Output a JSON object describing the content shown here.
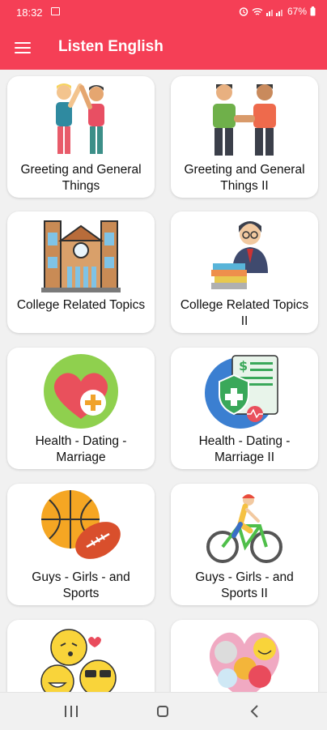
{
  "status_bar": {
    "time": "18:32",
    "battery": "67%"
  },
  "app_bar": {
    "title": "Listen English",
    "menu_icon": "hamburger-menu-icon",
    "color": "#f53f56"
  },
  "cards": [
    {
      "label": "Greeting and General Things",
      "icon": "high-five-people-icon"
    },
    {
      "label": "Greeting and General Things II",
      "icon": "handshake-people-icon"
    },
    {
      "label": "College Related Topics",
      "icon": "college-building-icon"
    },
    {
      "label": "College Related Topics II",
      "icon": "professor-books-icon"
    },
    {
      "label": "Health - Dating - Marriage",
      "icon": "heart-health-icon"
    },
    {
      "label": "Health - Dating - Marriage II",
      "icon": "health-insurance-document-icon"
    },
    {
      "label": "Guys - Girls - and Sports",
      "icon": "basketball-football-icon"
    },
    {
      "label": "Guys - Girls - and Sports II",
      "icon": "cyclist-icon"
    },
    {
      "label": "",
      "icon": "emoji-faces-icon"
    },
    {
      "label": "",
      "icon": "emotions-heart-icon"
    }
  ],
  "nav_bar": {
    "recent": "recent-apps-icon",
    "home": "home-icon",
    "back": "back-icon"
  }
}
